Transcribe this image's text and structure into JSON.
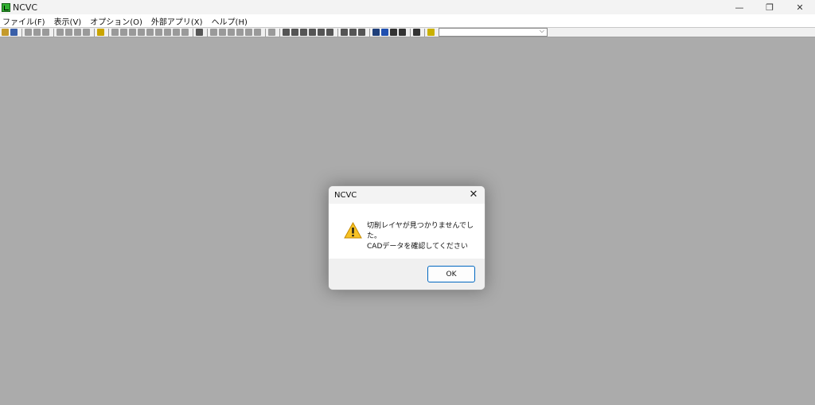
{
  "window": {
    "title": "NCVC",
    "minimize_glyph": "—",
    "restore_glyph": "❐",
    "close_glyph": "✕"
  },
  "menu": {
    "items": [
      {
        "label": "ファイル(F)"
      },
      {
        "label": "表示(V)"
      },
      {
        "label": "オプション(O)"
      },
      {
        "label": "外部アプリ(X)"
      },
      {
        "label": "ヘルプ(H)"
      }
    ]
  },
  "toolbar": {
    "combo_value": "",
    "buttons": [
      {
        "icon": "open-icon",
        "color": "#c49a2b"
      },
      {
        "icon": "save-icon",
        "color": "#3a5fa8"
      },
      {
        "sep": true
      },
      {
        "icon": "cut-icon",
        "color": "#9a9a9a"
      },
      {
        "icon": "copy-icon",
        "color": "#9a9a9a"
      },
      {
        "icon": "paste-icon",
        "color": "#9a9a9a"
      },
      {
        "sep": true
      },
      {
        "icon": "fit-icon",
        "color": "#9a9a9a"
      },
      {
        "icon": "zoom-icon",
        "color": "#9a9a9a"
      },
      {
        "icon": "zoom-in-icon",
        "color": "#9a9a9a"
      },
      {
        "icon": "zoom-out-icon",
        "color": "#9a9a9a"
      },
      {
        "sep": true
      },
      {
        "icon": "key-icon",
        "color": "#c9a400"
      },
      {
        "sep": true
      },
      {
        "icon": "view-1-icon",
        "color": "#9a9a9a"
      },
      {
        "icon": "view-2-icon",
        "color": "#9a9a9a"
      },
      {
        "icon": "view-3-icon",
        "color": "#9a9a9a"
      },
      {
        "icon": "view-4-icon",
        "color": "#9a9a9a"
      },
      {
        "icon": "view-5-icon",
        "color": "#9a9a9a"
      },
      {
        "icon": "hand-icon",
        "color": "#9a9a9a"
      },
      {
        "icon": "prev-icon",
        "color": "#9a9a9a"
      },
      {
        "icon": "fast-forward-icon",
        "color": "#9a9a9a"
      },
      {
        "icon": "play-icon",
        "color": "#9a9a9a"
      },
      {
        "sep": true
      },
      {
        "icon": "print-icon",
        "color": "#555555"
      },
      {
        "sep": true
      },
      {
        "icon": "tool-1-icon",
        "color": "#9a9a9a"
      },
      {
        "icon": "tool-2-icon",
        "color": "#9a9a9a"
      },
      {
        "icon": "tool-3-icon",
        "color": "#9a9a9a"
      },
      {
        "icon": "tool-4-icon",
        "color": "#9a9a9a"
      },
      {
        "icon": "tool-5-icon",
        "color": "#9a9a9a"
      },
      {
        "icon": "tool-6-icon",
        "color": "#9a9a9a"
      },
      {
        "sep": true
      },
      {
        "icon": "grid-icon",
        "color": "#9a9a9a"
      },
      {
        "sep": true
      },
      {
        "icon": "expand-icon",
        "color": "#555555"
      },
      {
        "icon": "check-icon",
        "color": "#555555"
      },
      {
        "icon": "double-left-icon",
        "color": "#555555"
      },
      {
        "icon": "square-icon",
        "color": "#555555"
      },
      {
        "icon": "bracket-icon",
        "color": "#555555"
      },
      {
        "icon": "cross-icon",
        "color": "#555555"
      },
      {
        "sep": true
      },
      {
        "icon": "flag-icon",
        "color": "#555555"
      },
      {
        "icon": "circle-icon",
        "color": "#555555"
      },
      {
        "icon": "window-icon",
        "color": "#555555"
      },
      {
        "sep": true
      },
      {
        "icon": "globe-icon",
        "color": "#1f3f7a"
      },
      {
        "icon": "blue-box-icon",
        "color": "#1f4fb0"
      },
      {
        "icon": "dark-box-1-icon",
        "color": "#333333"
      },
      {
        "icon": "dark-box-2-icon",
        "color": "#333333"
      },
      {
        "sep": true
      },
      {
        "icon": "layers-icon",
        "color": "#333333"
      },
      {
        "sep": true
      },
      {
        "icon": "funnel-icon",
        "color": "#c9b000"
      }
    ]
  },
  "dialog": {
    "title": "NCVC",
    "close_glyph": "✕",
    "icon": "warning-icon",
    "message_line1": "切削レイヤが見つかりませんでした。",
    "message_line2": "CADデータを確認してください",
    "ok_label": "OK"
  },
  "colors": {
    "workspace": "#ababab",
    "warning_fill": "#f7c224",
    "accent": "#0067c0"
  }
}
